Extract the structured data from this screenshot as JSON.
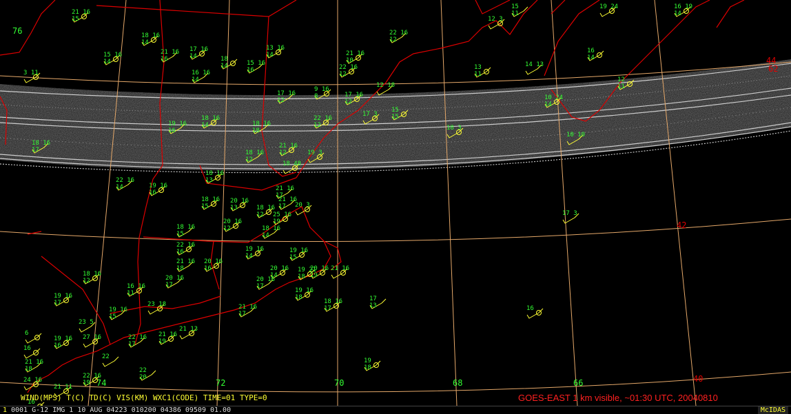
{
  "legend": "WIND(MPS)  T(C)  TD(C)  VIS(KM)  WXC1(CODE)    TIME=01  TYPE=0",
  "caption": "GOES-EAST 1 km visible, ~01:30 UTC, 20040810",
  "status": {
    "frame": "1",
    "text": "0001 G-12 IMG    1 10 AUG 04223 010200 04386 09509 01.00",
    "brand": "McIDAS"
  },
  "grid_labels": {
    "lon": [
      "74",
      "72",
      "70",
      "68",
      "66",
      "76"
    ],
    "lat": [
      "42",
      "40",
      "62",
      "44"
    ]
  },
  "colors": {
    "background": "#000000",
    "station_text": "#33ff33",
    "wind_barb": "#ffff33",
    "state_border": "#dd0000",
    "graticule": "#e6a96a",
    "caption": "#ff2020"
  },
  "stations": [
    [
      "21 16",
      "15"
    ],
    [
      "22 16",
      "12"
    ],
    [
      "18 16",
      "14"
    ],
    [
      "15 16",
      "14"
    ],
    [
      "21 16",
      "16"
    ],
    [
      "17 16",
      "14"
    ],
    [
      "18",
      "14"
    ],
    [
      "15 16",
      "16"
    ],
    [
      "13 16",
      "14"
    ],
    [
      "3 11",
      ""
    ],
    [
      "16 16",
      "14"
    ],
    [
      "21 16",
      "10"
    ],
    [
      "22 16",
      "12"
    ],
    [
      "17 16",
      "12"
    ],
    [
      "9 16",
      "8"
    ],
    [
      "17 16",
      "12"
    ],
    [
      "19 16",
      "16"
    ],
    [
      "18 16",
      "14"
    ],
    [
      "22 16",
      "12"
    ],
    [
      "18 16",
      "18"
    ],
    [
      "17 3",
      ""
    ],
    [
      "15",
      "15"
    ],
    [
      "12 18",
      ""
    ],
    [
      "18 3",
      ""
    ],
    [
      "10 24",
      "14"
    ],
    [
      "10 10",
      ""
    ],
    [
      "12",
      "11"
    ],
    [
      "13",
      "11"
    ],
    [
      "14 13",
      ""
    ],
    [
      "16",
      "14"
    ],
    [
      "12 3",
      ""
    ],
    [
      "15",
      "11"
    ],
    [
      "19 24",
      ""
    ],
    [
      "16 19",
      "14"
    ],
    [
      "18 16",
      "17"
    ],
    [
      "21 16",
      "12"
    ],
    [
      "19 3",
      ""
    ],
    [
      "18 16",
      "12"
    ],
    [
      "18 48",
      ""
    ],
    [
      "18 16",
      "13"
    ],
    [
      "22 16",
      "14"
    ],
    [
      "19 16",
      "16"
    ],
    [
      "20 16",
      "13"
    ],
    [
      "21 16",
      "17"
    ],
    [
      "18 16",
      "15"
    ],
    [
      "18 16",
      "12"
    ],
    [
      "21 16",
      "17"
    ],
    [
      "20 3",
      ""
    ],
    [
      "25 16",
      "19"
    ],
    [
      "18 16",
      "15"
    ],
    [
      "20 16",
      "12"
    ],
    [
      "22 16",
      "16"
    ],
    [
      "18 16",
      "14"
    ],
    [
      "20 16",
      "16"
    ],
    [
      "19 16",
      "14"
    ],
    [
      "21 16",
      "18"
    ],
    [
      "19 16",
      "15"
    ],
    [
      "20 16",
      "14"
    ],
    [
      "20 16",
      "17"
    ],
    [
      "19 21",
      "18"
    ],
    [
      "20 16",
      "19"
    ],
    [
      "20 16",
      "17"
    ],
    [
      "21 16",
      ""
    ],
    [
      "19 16",
      "17"
    ],
    [
      "21 16",
      "17"
    ],
    [
      "19 16",
      "18"
    ],
    [
      "18 16",
      "17"
    ],
    [
      "17",
      "13"
    ],
    [
      "16",
      ""
    ],
    [
      "19",
      "18"
    ],
    [
      "22",
      "20"
    ],
    [
      "18 16",
      "12"
    ],
    [
      "16 16",
      "11"
    ],
    [
      "19 16",
      "15"
    ],
    [
      "19 16",
      "16"
    ],
    [
      "23 18",
      ""
    ],
    [
      "22 16",
      "17"
    ],
    [
      "21 13",
      ""
    ],
    [
      "21 16",
      "19"
    ],
    [
      "23 5",
      ""
    ],
    [
      "27 16",
      ""
    ],
    [
      "22 16",
      "19"
    ],
    [
      "21 16",
      "18"
    ],
    [
      "24 16",
      ""
    ],
    [
      "21 11",
      ""
    ],
    [
      "22",
      ""
    ],
    [
      "16",
      ""
    ],
    [
      "6",
      ""
    ],
    [
      "17 3",
      ""
    ],
    [
      "16",
      ""
    ]
  ]
}
